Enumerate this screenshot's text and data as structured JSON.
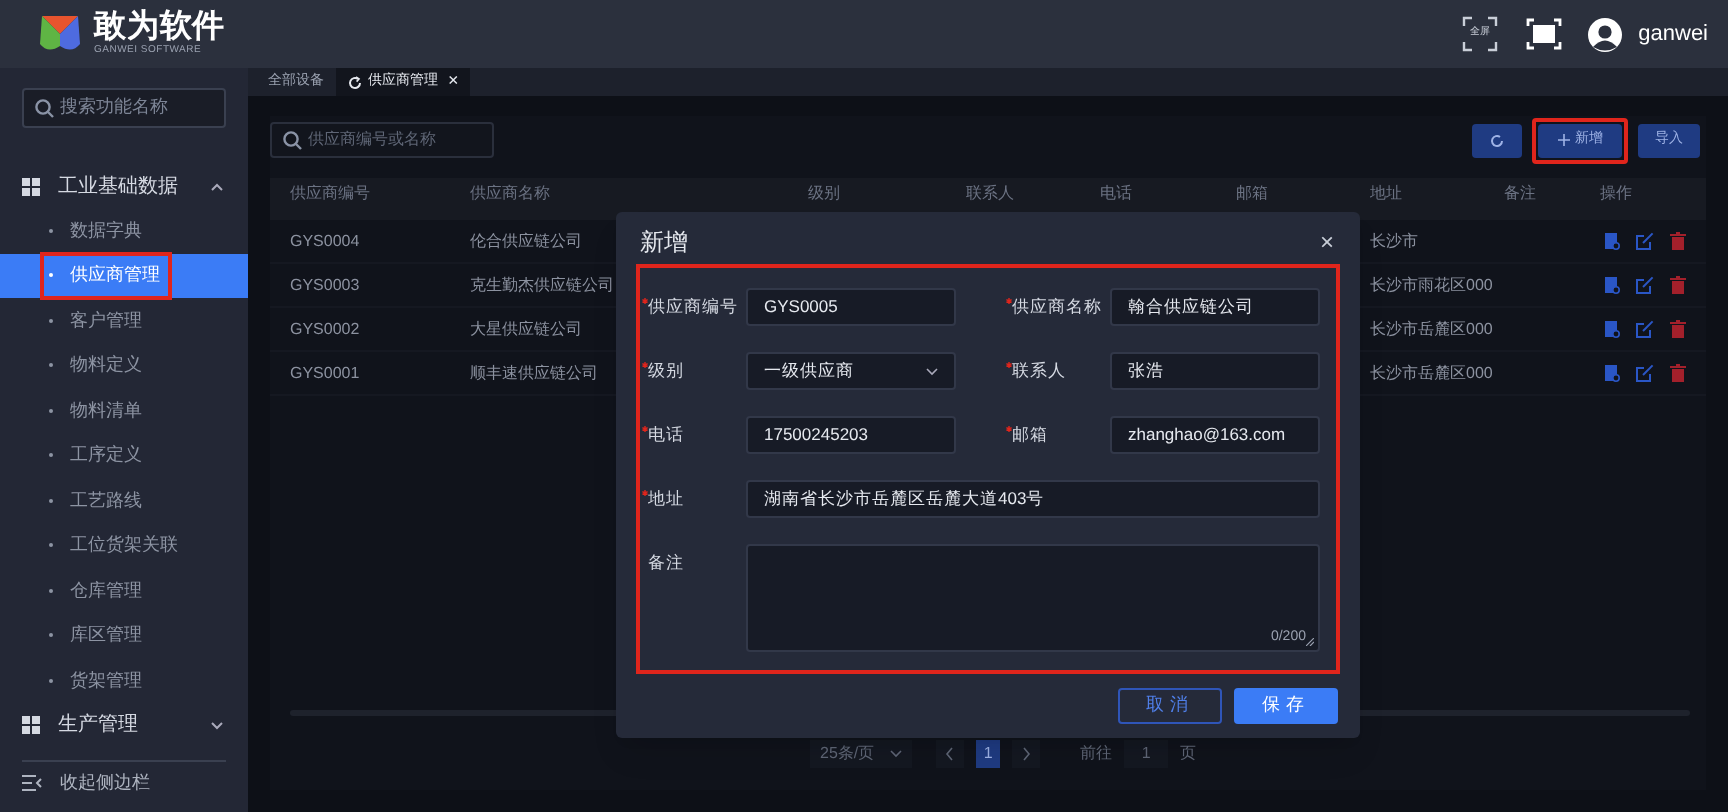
{
  "header": {
    "logo_title": "敢为软件",
    "logo_subtitle": "GANWEI SOFTWARE",
    "fullscreen_label": "全屏",
    "username": "ganwei"
  },
  "sidebar": {
    "search_placeholder": "搜索功能名称",
    "groups": [
      {
        "label": "工业基础数据",
        "expanded": true,
        "children": [
          {
            "label": "数据字典",
            "selected": false,
            "highlighted": false
          },
          {
            "label": "供应商管理",
            "selected": true,
            "highlighted": true
          },
          {
            "label": "客户管理",
            "selected": false,
            "highlighted": false
          },
          {
            "label": "物料定义",
            "selected": false,
            "highlighted": false
          },
          {
            "label": "物料清单",
            "selected": false,
            "highlighted": false
          },
          {
            "label": "工序定义",
            "selected": false,
            "highlighted": false
          },
          {
            "label": "工艺路线",
            "selected": false,
            "highlighted": false
          },
          {
            "label": "工位货架关联",
            "selected": false,
            "highlighted": false
          },
          {
            "label": "仓库管理",
            "selected": false,
            "highlighted": false
          },
          {
            "label": "库区管理",
            "selected": false,
            "highlighted": false
          },
          {
            "label": "货架管理",
            "selected": false,
            "highlighted": false
          }
        ]
      },
      {
        "label": "生产管理",
        "expanded": false
      }
    ],
    "collapse_label": "收起侧边栏"
  },
  "tabs": [
    {
      "label": "全部设备",
      "selected": false,
      "closable": false
    },
    {
      "label": "供应商管理",
      "selected": true,
      "closable": true,
      "close": "×"
    }
  ],
  "toolbar": {
    "search_placeholder": "供应商编号或名称",
    "buttons": [
      {
        "kind": "refresh",
        "highlighted": false
      },
      {
        "kind": "add",
        "label": "新增",
        "highlighted": true
      },
      {
        "kind": "text",
        "label": "导入",
        "highlighted": false
      }
    ]
  },
  "table": {
    "columns": [
      "供应商编号",
      "供应商名称",
      "级别",
      "联系人",
      "电话",
      "邮箱",
      "地址",
      "备注",
      "操作"
    ],
    "rows": [
      {
        "code": "GYS0004",
        "name": "伦合供应链公司",
        "address": "长沙市"
      },
      {
        "code": "GYS0003",
        "name": "克生勤杰供应链公司",
        "address": "长沙市雨花区000"
      },
      {
        "code": "GYS0002",
        "name": "大星供应链公司",
        "address": "长沙市岳麓区000"
      },
      {
        "code": "GYS0001",
        "name": "顺丰速供应链公司",
        "address": "长沙市岳麓区000"
      }
    ]
  },
  "pagination": {
    "page_size": "25条/页",
    "pages": [
      {
        "label": "1",
        "selected": true
      }
    ],
    "goto_label": "前往",
    "goto_value": "1",
    "page_unit": "页"
  },
  "modal": {
    "title": "新增",
    "close": "×",
    "highlighted": true,
    "fields": [
      {
        "label": "供应商编号",
        "required": true,
        "kind": "input",
        "value": "GYS0005"
      },
      {
        "label": "供应商名称",
        "required": true,
        "kind": "input",
        "value": "翰合供应链公司"
      },
      {
        "label": "级别",
        "required": true,
        "kind": "select",
        "value": "一级供应商"
      },
      {
        "label": "联系人",
        "required": true,
        "kind": "input",
        "value": "张浩"
      },
      {
        "label": "电话",
        "required": true,
        "kind": "input",
        "value": "17500245203"
      },
      {
        "label": "邮箱",
        "required": true,
        "kind": "input",
        "value": "zhanghao@163.com"
      },
      {
        "label": "地址",
        "required": true,
        "kind": "wide",
        "value": "湖南省长沙市岳麓区岳麓大道403号"
      },
      {
        "label": "备注",
        "required": false,
        "kind": "textarea",
        "counter": "0/200"
      }
    ],
    "buttons": [
      {
        "kind": "secondary",
        "label": "取消"
      },
      {
        "kind": "primary",
        "label": "保存"
      }
    ]
  }
}
